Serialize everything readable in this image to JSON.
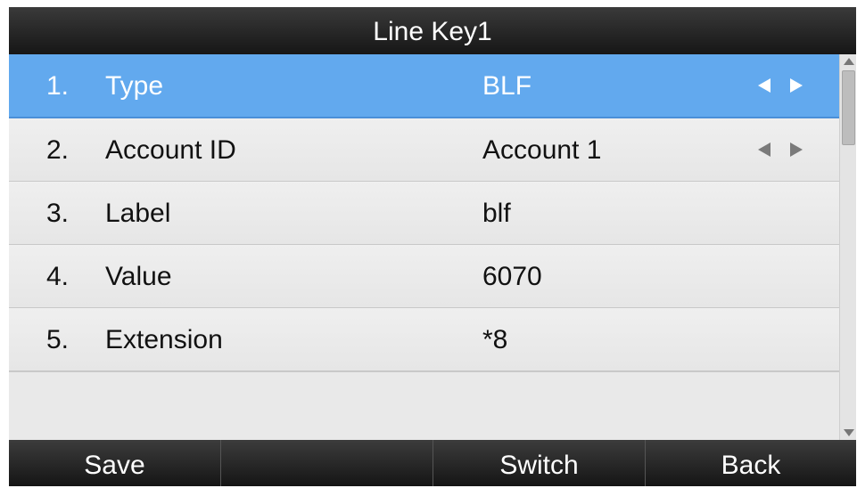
{
  "title": "Line Key1",
  "rows": [
    {
      "number": "1.",
      "label": "Type",
      "value": "BLF",
      "has_arrows": true,
      "selected": true
    },
    {
      "number": "2.",
      "label": "Account ID",
      "value": "Account 1",
      "has_arrows": true,
      "selected": false
    },
    {
      "number": "3.",
      "label": "Label",
      "value": "blf",
      "has_arrows": false,
      "selected": false
    },
    {
      "number": "4.",
      "label": "Value",
      "value": "6070",
      "has_arrows": false,
      "selected": false
    },
    {
      "number": "5.",
      "label": "Extension",
      "value": "*8",
      "has_arrows": false,
      "selected": false
    }
  ],
  "softkeys": [
    {
      "label": "Save"
    },
    {
      "label": ""
    },
    {
      "label": "Switch"
    },
    {
      "label": "Back"
    }
  ],
  "colors": {
    "selected_row": "#62a9ee",
    "title_bar": "#1e1e1e",
    "softkey_bar": "#1e1e1e",
    "row_background": "#ececec"
  },
  "icons": {
    "left_arrow": "left-arrow-icon",
    "right_arrow": "right-arrow-icon",
    "scroll_up": "scroll-up-icon",
    "scroll_down": "scroll-down-icon"
  }
}
